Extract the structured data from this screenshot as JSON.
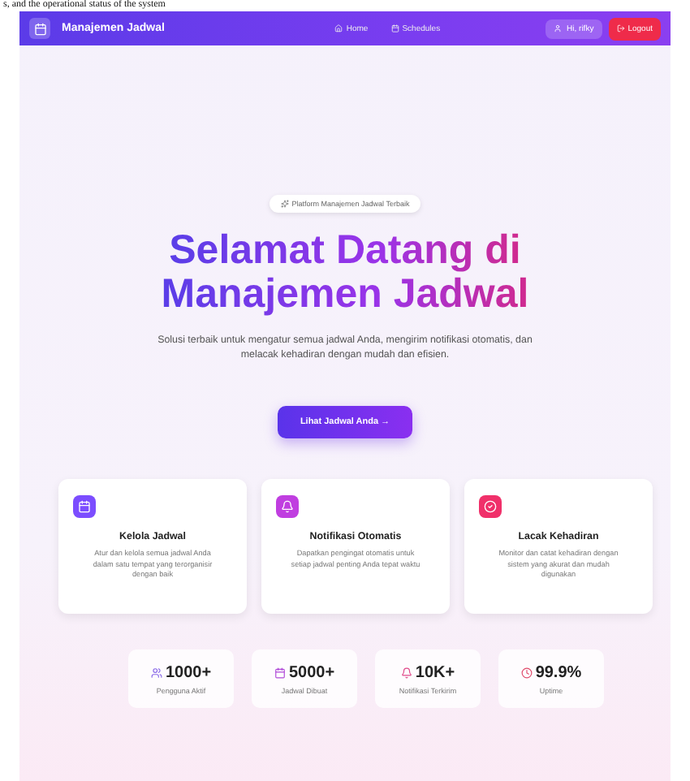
{
  "caption": "s, and the operational status of the system",
  "navbar": {
    "brand": "Manajemen Jadwal",
    "links": [
      {
        "label": "Home"
      },
      {
        "label": "Schedules"
      }
    ],
    "user": "Hi, rifky",
    "logout": "Logout"
  },
  "hero": {
    "badge": "Platform Manajemen Jadwal Terbaik",
    "title_line_1": "Selamat Datang di",
    "title_line_2": "Manajemen Jadwal",
    "subtitle": "Solusi terbaik untuk mengatur semua jadwal Anda, mengirim notifikasi otomatis, dan melacak kehadiran dengan mudah dan efisien.",
    "button": "Lihat Jadwal Anda →"
  },
  "features": [
    {
      "color": "#7c4dff",
      "title": "Kelola Jadwal",
      "text": "Atur dan kelola semua jadwal Anda dalam satu tempat yang terorganisir dengan baik"
    },
    {
      "color": "#c03ee0",
      "title": "Notifikasi Otomatis",
      "text": "Dapatkan pengingat otomatis untuk setiap jadwal penting Anda tepat waktu"
    },
    {
      "color": "#f0306a",
      "title": "Lacak Kehadiran",
      "text": "Monitor dan catat kehadiran dengan sistem yang akurat dan mudah digunakan"
    }
  ],
  "stats": [
    {
      "value": "1000+",
      "label": "Pengguna Aktif"
    },
    {
      "value": "5000+",
      "label": "Jadwal Dibuat"
    },
    {
      "value": "10K+",
      "label": "Notifikasi Terkirim"
    },
    {
      "value": "99.9%",
      "label": "Uptime"
    }
  ]
}
